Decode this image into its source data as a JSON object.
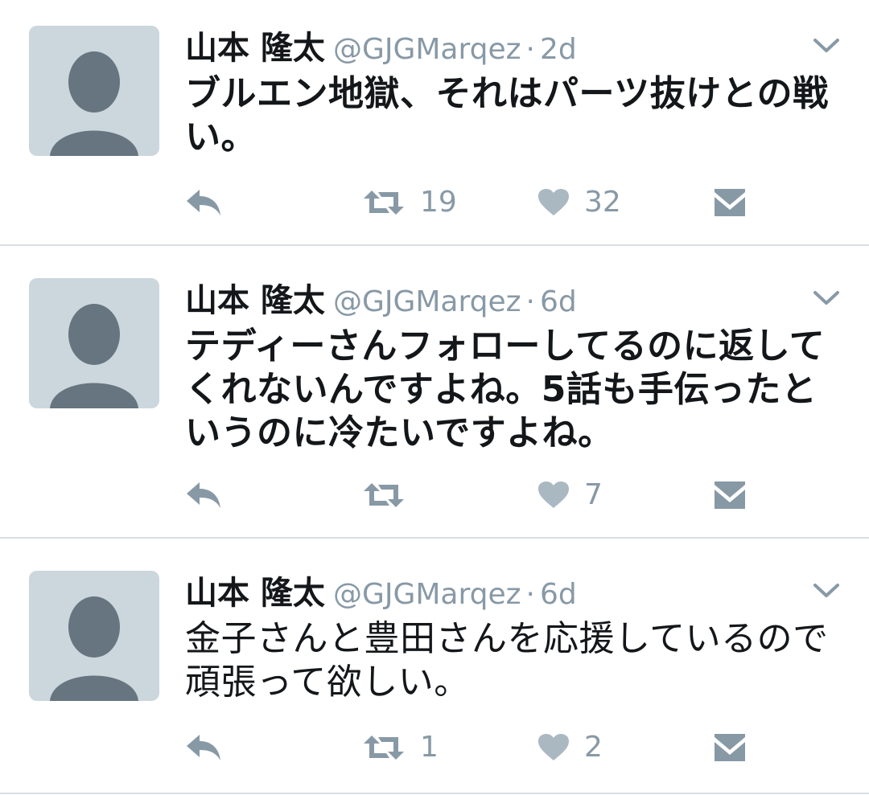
{
  "tweets": [
    {
      "name": "山本 隆太",
      "handle": "@GJGMarqez",
      "separator": "·",
      "time": "2d",
      "text": "ブルエン地獄、それはパーツ抜けとの戦い。",
      "retweets": "19",
      "likes": "32"
    },
    {
      "name": "山本 隆太",
      "handle": "@GJGMarqez",
      "separator": "·",
      "time": "6d",
      "text": "テディーさんフォローしてるのに返してくれないんですよね。5話も手伝ったというのに冷たいですよね。",
      "retweets": "",
      "likes": "7"
    },
    {
      "name": "山本 隆太",
      "handle": "@GJGMarqez",
      "separator": "·",
      "time": "6d",
      "text": "金子さんと豊田さんを応援しているので頑張って欲しい。",
      "retweets": "1",
      "likes": "2"
    }
  ],
  "colors": {
    "text": "#14171a",
    "muted": "#8899a6",
    "avatar_bg": "#ccd6dd",
    "avatar_fg": "#66757f",
    "divider": "#d8dee3"
  },
  "icons": {
    "reply": "reply-icon",
    "retweet": "retweet-icon",
    "like": "heart-icon",
    "dm": "envelope-icon",
    "menu": "chevron-down-icon",
    "avatar": "default-avatar-icon"
  }
}
